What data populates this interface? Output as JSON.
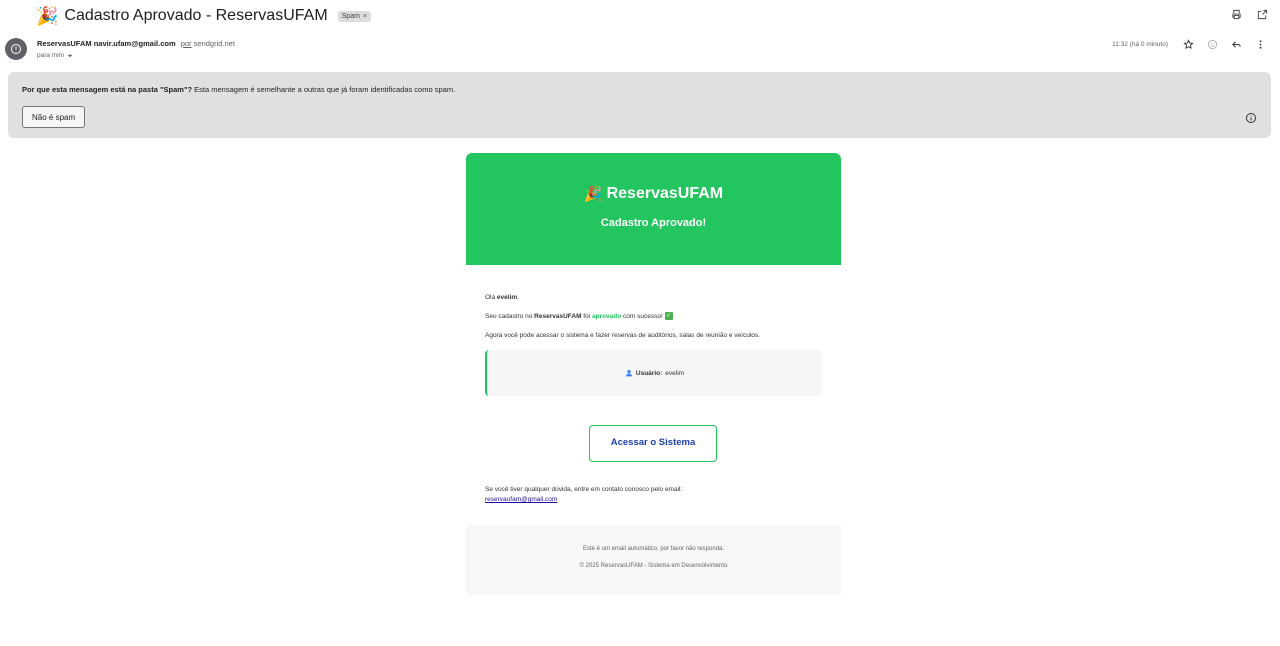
{
  "subject": {
    "emoji": "🎉",
    "title": "Cadastro Aprovado - ReservasUFAM",
    "label_chip": "Spam",
    "label_chip_close": "×"
  },
  "top_actions": {
    "icons": [
      "print-icon",
      "open-in-new-window-icon"
    ]
  },
  "sender": {
    "name_email": "ReservasUFAM navir.ufam@gmail.com",
    "via_prefix": "por",
    "via_domain": "sendgrid.net",
    "to": "para mim"
  },
  "meta": {
    "time": "11:32 (há 0 minuto)",
    "icons": [
      "star-icon",
      "emoji-icon",
      "reply-icon",
      "more-vert-icon"
    ]
  },
  "spam_banner": {
    "question": "Por que esta mensagem está na pasta \"Spam\"?",
    "explanation": " Esta mensagem é semelhante a outras que já foram identificadas como spam.",
    "not_spam_button": "Não é spam"
  },
  "email": {
    "header": {
      "brand_emoji": "🎉",
      "brand": "ReservasUFAM",
      "subtitle": "Cadastro Aprovado!"
    },
    "greeting_prefix": "Olá ",
    "greeting_name": "evelim",
    "greeting_suffix": ",",
    "line1_prefix": "Seu cadastro no ",
    "line1_brand": "ReservasUFAM",
    "line1_mid": " foi ",
    "line1_status": "aprovado",
    "line1_suffix": " com sucesso! ",
    "line1_check": "✓",
    "line2": "Agora você pode acessar o sistema e fazer reservas de auditórios, salas de reunião e veículos.",
    "user_label": "Usuário:",
    "user_value": "evelim",
    "cta": "Acessar o Sistema",
    "contact_text": "Se você tiver qualquer dúvida, entre em contato conosco pelo email:",
    "contact_email": "reservaufam@gmail.com",
    "footer_line1": "Este é um email automático, por favor não responda.",
    "footer_line2": "© 2025 ReservasUFAM - Sistema em Desenvolvimento"
  },
  "colors": {
    "brand_green": "#22c55e",
    "cta_text": "#1e40af",
    "banner_bg": "#e0e0e0"
  }
}
